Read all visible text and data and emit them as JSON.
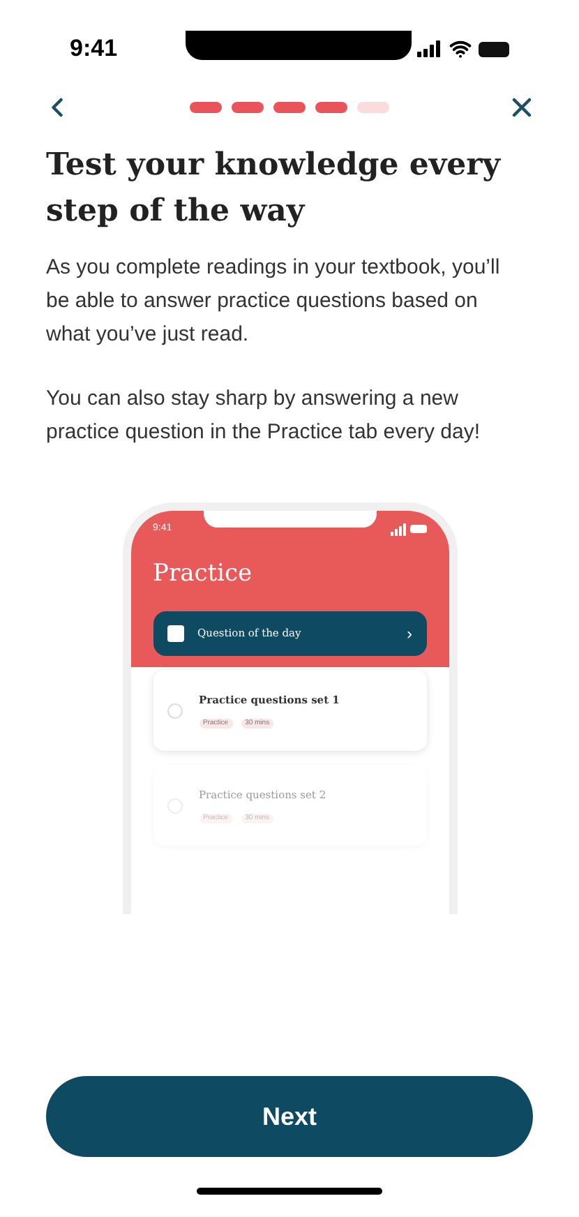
{
  "status_bar": {
    "time": "9:41"
  },
  "progress": [
    {
      "done": true
    },
    {
      "done": true
    },
    {
      "done": true
    },
    {
      "done": true
    },
    {
      "done": false
    }
  ],
  "title": "Test your knowledge every step of the way",
  "paragraphs": [
    "As you complete readings in your textbook, you’ll be able to answer practice questions based on what you’ve just read.",
    "You can also stay sharp by answering a new practice question in the Practice tab every day!"
  ],
  "preview": {
    "time": "9:41",
    "heading": "Practice",
    "question_of_day": {
      "label": "Question of the day",
      "arrow": "›"
    },
    "sets": [
      {
        "title": "Practice questions set 1",
        "tags": [
          "Practice",
          "30 mins"
        ],
        "faded": false
      },
      {
        "title": "Practice questions set 2",
        "tags": [
          "Practice",
          "30 mins"
        ],
        "faded": true
      }
    ]
  },
  "button": "Next"
}
